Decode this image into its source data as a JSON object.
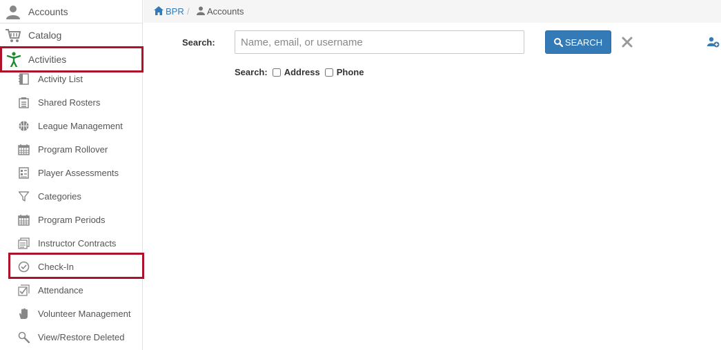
{
  "sidebar": {
    "top_items": [
      {
        "label": "Accounts",
        "icon": "user-icon"
      },
      {
        "label": "Catalog",
        "icon": "cart-icon"
      },
      {
        "label": "Activities",
        "icon": "activity-person-icon"
      }
    ],
    "sub_items": [
      {
        "label": "Activity List",
        "icon": "notebook-icon"
      },
      {
        "label": "Shared Rosters",
        "icon": "clipboard-icon"
      },
      {
        "label": "League Management",
        "icon": "basketball-icon"
      },
      {
        "label": "Program Rollover",
        "icon": "calendar-icon"
      },
      {
        "label": "Player Assessments",
        "icon": "assessment-icon"
      },
      {
        "label": "Categories",
        "icon": "filter-icon"
      },
      {
        "label": "Program Periods",
        "icon": "calendar-icon"
      },
      {
        "label": "Instructor Contracts",
        "icon": "contracts-icon"
      },
      {
        "label": "Check-In",
        "icon": "check-circle-icon"
      },
      {
        "label": "Attendance",
        "icon": "attendance-icon"
      },
      {
        "label": "Volunteer Management",
        "icon": "hand-icon"
      },
      {
        "label": "View/Restore Deleted",
        "icon": "magnifier-icon"
      }
    ]
  },
  "breadcrumb": {
    "home": "BPR",
    "separator": "/",
    "current": "Accounts"
  },
  "search": {
    "label": "Search:",
    "placeholder": "Name, email, or username",
    "button_label": "SEARCH",
    "options_label": "Search:",
    "option_address": "Address",
    "option_phone": "Phone"
  },
  "colors": {
    "accent": "#337ab7",
    "highlight": "#b0112a",
    "activity_green": "#1e8a2e"
  }
}
